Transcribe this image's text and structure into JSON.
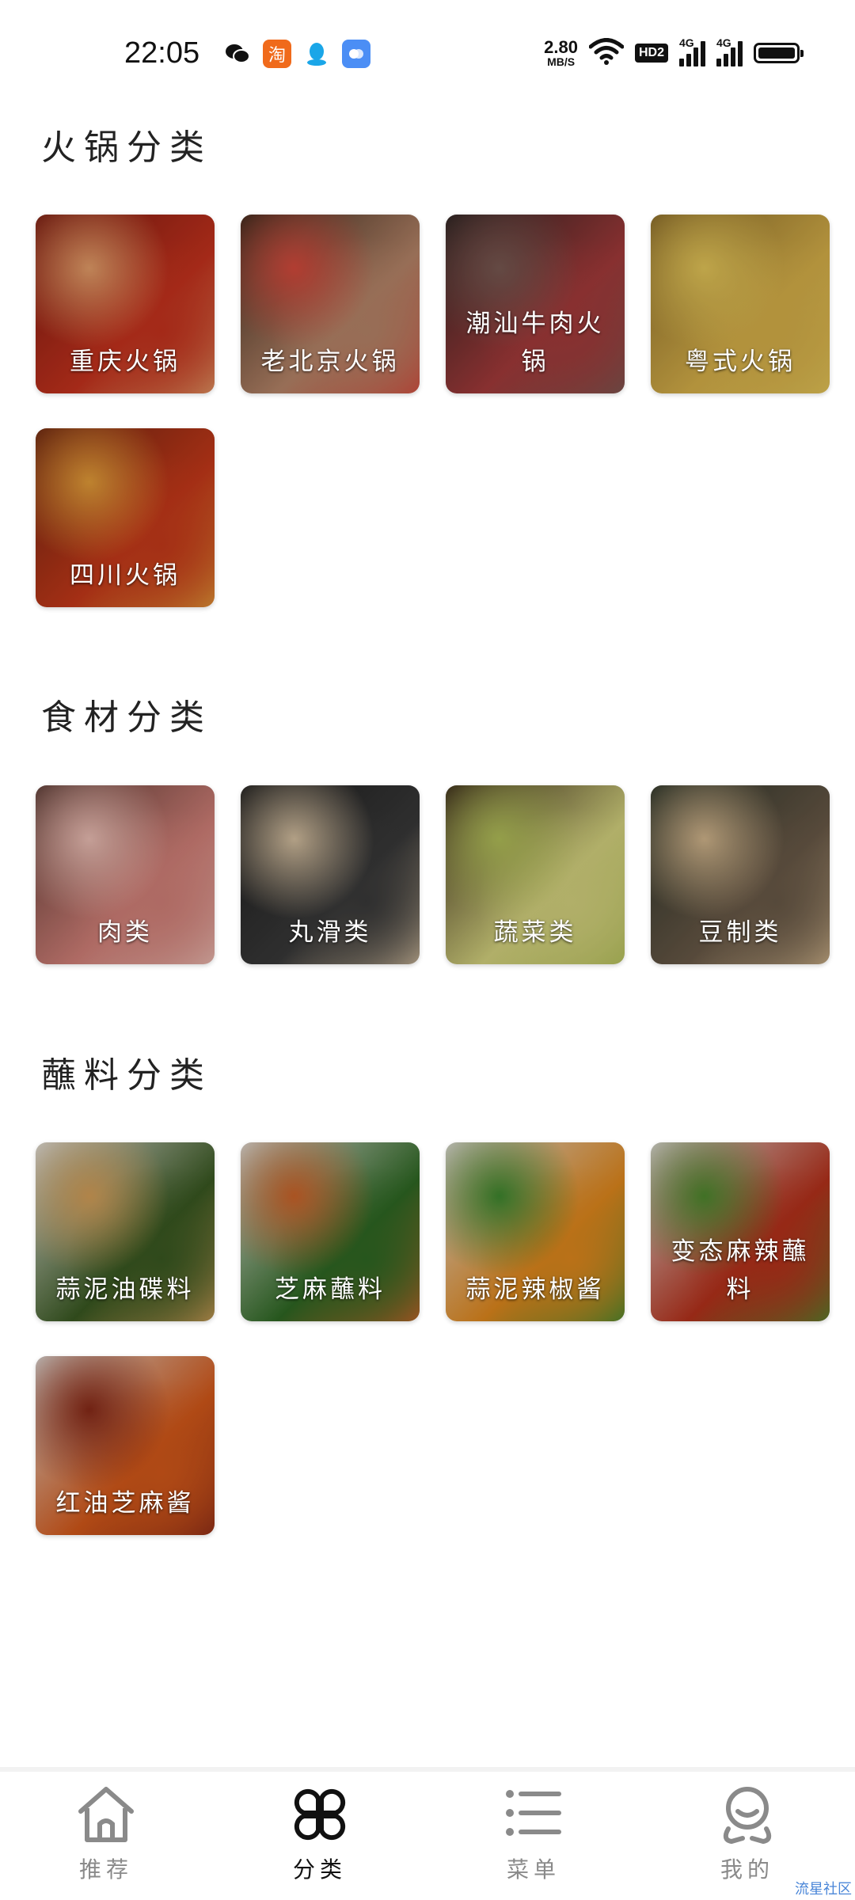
{
  "status_bar": {
    "time": "22:05",
    "notification_icons": [
      "wechat-icon",
      "taobao-icon",
      "qq-icon",
      "cloud-icon"
    ],
    "taobao_glyph": "淘",
    "net_speed_value": "2.80",
    "net_speed_unit": "MB/S",
    "hd_badge": "HD2",
    "signal1_label": "4G",
    "signal2_label": "4G",
    "battery_level": 1.0
  },
  "sections": [
    {
      "title": "火锅分类",
      "items": [
        {
          "label": "重庆火锅",
          "colors": [
            "#7a1a10",
            "#c8331e",
            "#e9a16b"
          ]
        },
        {
          "label": "老北京火锅",
          "colors": [
            "#3b2a1d",
            "#b9876a",
            "#d94b3d"
          ]
        },
        {
          "label": "潮汕牛肉火锅",
          "colors": [
            "#2c2422",
            "#a63b3b",
            "#7a5a53"
          ]
        },
        {
          "label": "粤式火锅",
          "colors": [
            "#8a6b2a",
            "#d9b24a",
            "#e8c95a"
          ]
        },
        {
          "label": "四川火锅",
          "colors": [
            "#6b2410",
            "#c93a1a",
            "#e8a03a"
          ]
        }
      ]
    },
    {
      "title": "食材分类",
      "items": [
        {
          "label": "肉类",
          "colors": [
            "#5a3a33",
            "#d5827a",
            "#f0c2b8"
          ]
        },
        {
          "label": "丸滑类",
          "colors": [
            "#1d1d1d",
            "#3a3a3a",
            "#d9c3a3"
          ]
        },
        {
          "label": "蔬菜类",
          "colors": [
            "#3a2a1a",
            "#d8d680",
            "#b5c25a"
          ]
        },
        {
          "label": "豆制类",
          "colors": [
            "#2a3328",
            "#6a5a48",
            "#d6b98f"
          ]
        }
      ]
    },
    {
      "title": "蘸料分类",
      "items": [
        {
          "label": "蒜泥油碟料",
          "colors": [
            "#e9e6e2",
            "#3a5a22",
            "#d8a25a"
          ]
        },
        {
          "label": "芝麻蘸料",
          "colors": [
            "#e6e3df",
            "#2f6a24",
            "#d0662a"
          ]
        },
        {
          "label": "蒜泥辣椒酱",
          "colors": [
            "#e6e3df",
            "#e38a1e",
            "#3f8a2f"
          ]
        },
        {
          "label": "变态麻辣蘸料",
          "colors": [
            "#e4e1dc",
            "#b8321c",
            "#4f8a2e"
          ]
        },
        {
          "label": "红油芝麻酱",
          "colors": [
            "#e5e2de",
            "#d75a1a",
            "#8a2a18"
          ]
        }
      ]
    }
  ],
  "bottom_nav": {
    "items": [
      {
        "label": "推荐",
        "icon": "home-icon",
        "active": false
      },
      {
        "label": "分类",
        "icon": "category-icon",
        "active": true
      },
      {
        "label": "菜单",
        "icon": "list-icon",
        "active": false
      },
      {
        "label": "我的",
        "icon": "profile-icon",
        "active": false
      }
    ]
  },
  "watermark": "流星社区"
}
